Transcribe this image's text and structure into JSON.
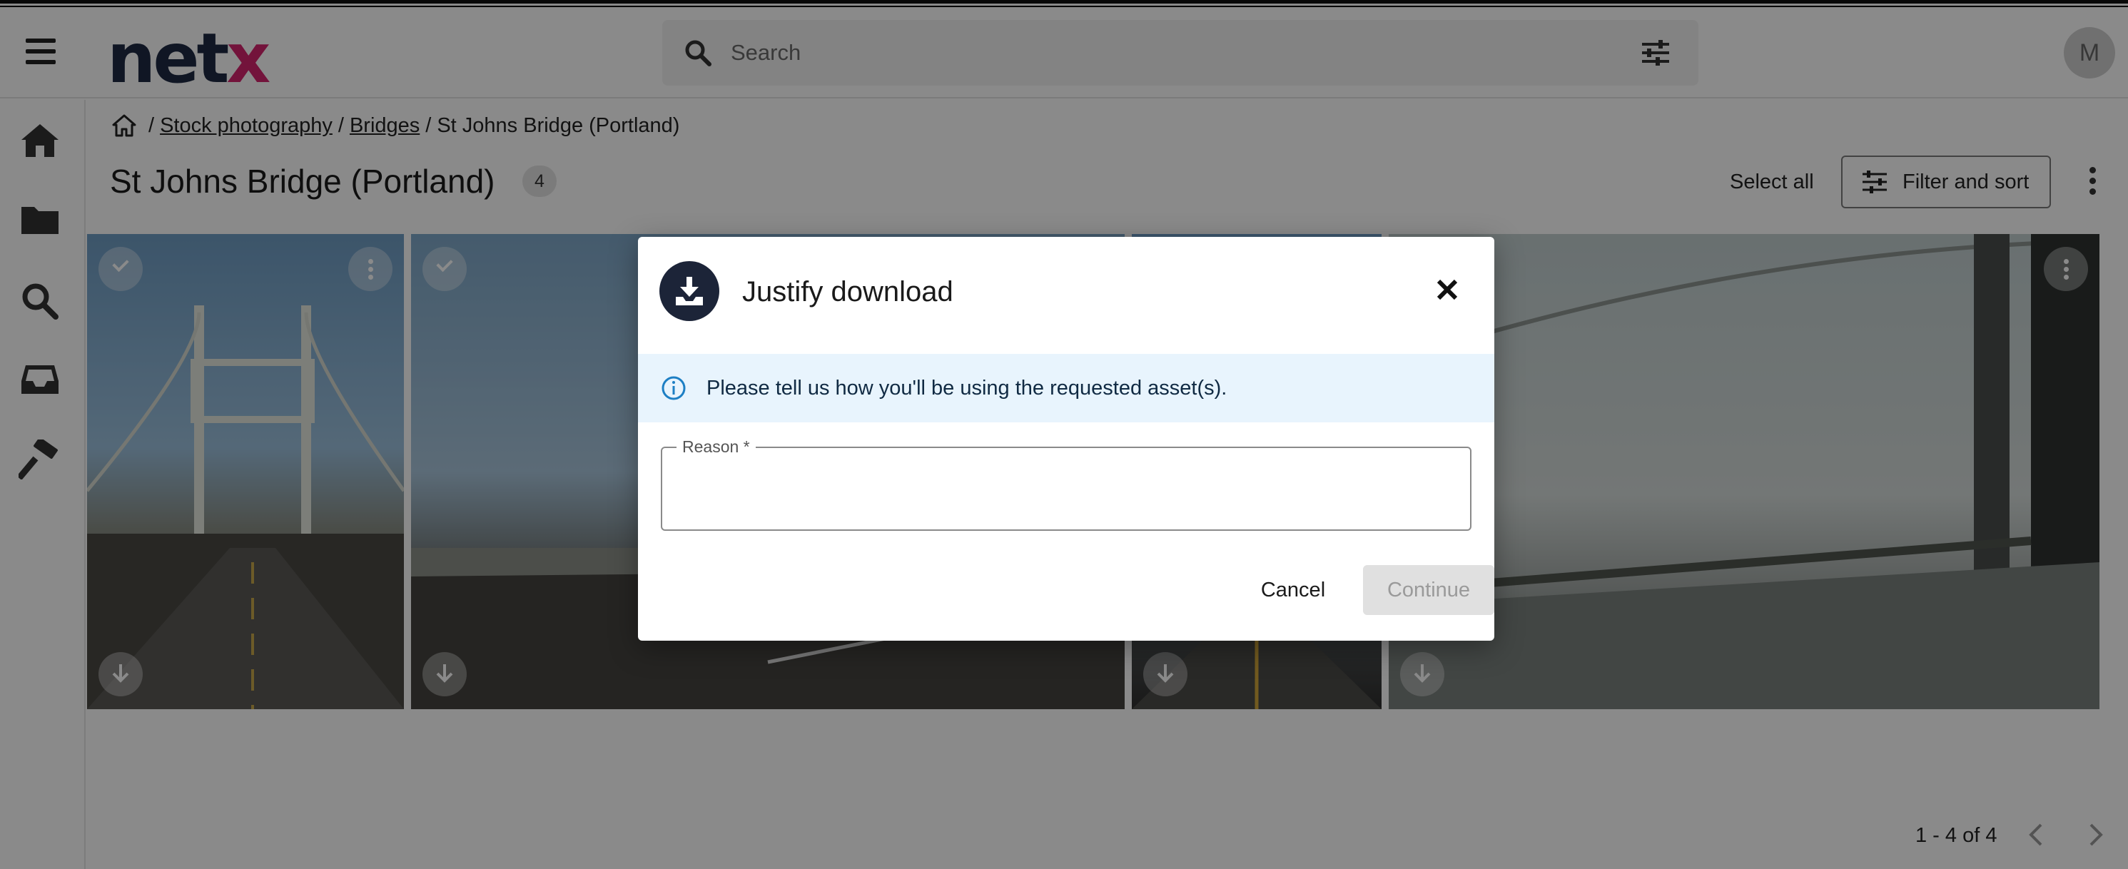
{
  "header": {
    "logo_main": "net",
    "logo_accent": "x",
    "search_placeholder": "Search",
    "avatar_initial": "M"
  },
  "sidebar": {
    "items": [
      {
        "icon": "home-icon"
      },
      {
        "icon": "folder-icon"
      },
      {
        "icon": "search-icon"
      },
      {
        "icon": "inbox-icon"
      },
      {
        "icon": "hammer-icon"
      }
    ]
  },
  "breadcrumb": {
    "items": [
      "Stock photography",
      "Bridges"
    ],
    "current": "St Johns Bridge (Portland)",
    "separator": "/"
  },
  "page": {
    "title": "St Johns Bridge (Portland)",
    "count": "4",
    "select_all": "Select all",
    "filter_label": "Filter and sort"
  },
  "pagination": {
    "range": "1 - 4 of 4"
  },
  "modal": {
    "title": "Justify download",
    "info": "Please tell us how you'll be using the requested asset(s).",
    "reason_label": "Reason *",
    "reason_value": "",
    "cancel_label": "Cancel",
    "continue_label": "Continue"
  },
  "colors": {
    "logo_dark": "#1e2a44",
    "logo_accent": "#d4236e",
    "info_bg": "#e8f4fd",
    "icon_circle": "#1c2438"
  }
}
